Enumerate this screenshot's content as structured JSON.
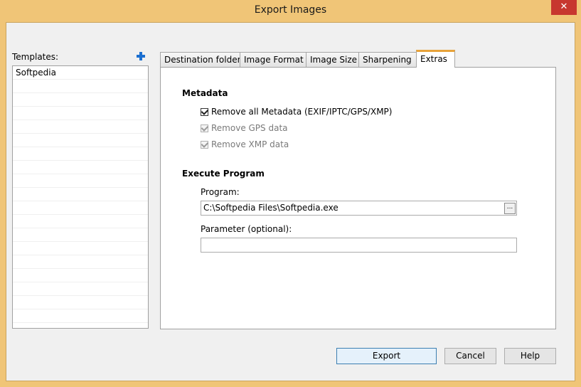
{
  "window": {
    "title": "Export Images",
    "close_glyph": "✕"
  },
  "templates": {
    "label": "Templates:",
    "items": [
      "Softpedia"
    ],
    "empty_rows": 18
  },
  "tabs": [
    {
      "label": "Destination folder",
      "active": false
    },
    {
      "label": "Image Format",
      "active": false
    },
    {
      "label": "Image Size",
      "active": false
    },
    {
      "label": "Sharpening",
      "active": false
    },
    {
      "label": "Extras",
      "active": true
    }
  ],
  "extras": {
    "metadata_heading": "Metadata",
    "remove_all": {
      "label": "Remove all Metadata (EXIF/IPTC/GPS/XMP)",
      "checked": true,
      "enabled": true
    },
    "remove_gps": {
      "label": "Remove GPS data",
      "checked": true,
      "enabled": false
    },
    "remove_xmp": {
      "label": "Remove XMP data",
      "checked": true,
      "enabled": false
    },
    "execute_heading": "Execute Program",
    "program_label": "Program:",
    "program_value": "C:\\Softpedia Files\\Softpedia.exe",
    "browse_label": "...",
    "parameter_label": "Parameter (optional):",
    "parameter_value": ""
  },
  "buttons": {
    "export": "Export",
    "cancel": "Cancel",
    "help": "Help"
  },
  "colors": {
    "frame": "#f0c577",
    "close": "#c7372f",
    "tab_accent": "#e8a33a",
    "add_icon": "#1b6fd0"
  }
}
